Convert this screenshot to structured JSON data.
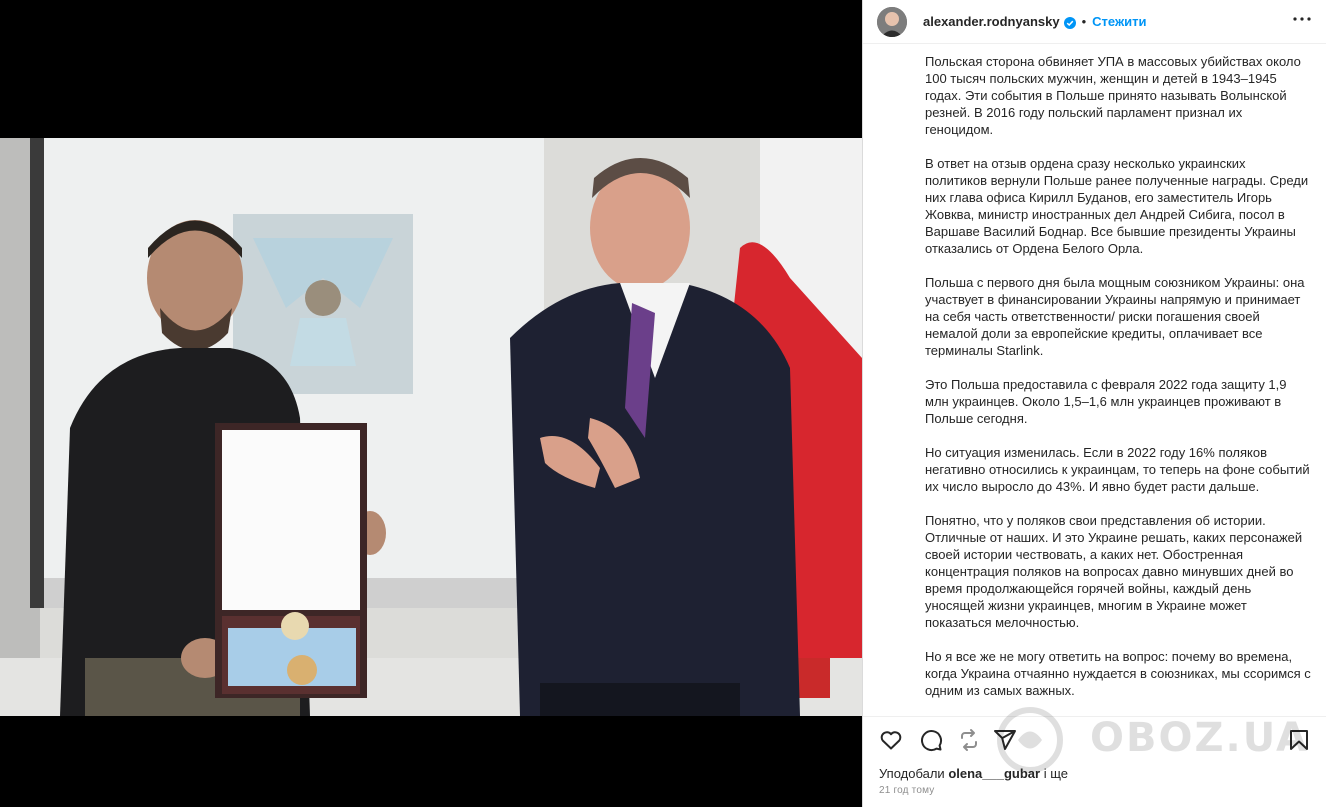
{
  "post": {
    "username": "alexander.rodnyansky",
    "follow_label": "Стежити",
    "separator": "•",
    "caption": [
      "Польская сторона обвиняет УПА в массовых убийствах около 100 тысяч польских мужчин, женщин и детей в 1943–1945 годах. Эти события в Польше принято называть Волынской резней. В 2016 году польский парламент признал их геноцидом.",
      "В ответ на отзыв ордена сразу несколько украинских политиков вернули Польше ранее полученные награды. Среди них глава офиса Кирилл Буданов, его заместитель Игорь Жовква, министр иностранных дел Андрей Сибига, посол в Варшаве Василий Боднар. Все бывшие президенты Украины отказались от Ордена Белого Орла.",
      "Польша с первого дня была мощным союзником Украины: она участвует в финансировании Украины напрямую и принимает на себя часть ответственности/ риски погашения своей немалой доли за европейские кредиты, оплачивает все терминалы Starlink.",
      "Это Польша предоставила с февраля 2022 года защиту 1,9 млн украинцев. Около 1,5–1,6 млн украинцев проживают в Польше сегодня.",
      "Но ситуация изменилась. Если в 2022 году 16% поляков негативно относились к украинцам, то теперь на фоне событий их число выросло до 43%. И явно будет расти дальше.",
      "Понятно, что у поляков свои представления об истории. Отличные от наших. И это Украине решать, каких персонажей своей истории чествовать, а каких нет. Обостренная концентрация поляков на вопросах давно минувших дней во время продолжающейся горячей войны, каждый день уносящей жизни украинцев, многим в Украине может показаться мелочностью.",
      "Но я все же не могу ответить на вопрос: почему во времена, когда Украина отчаянно нуждается в союзниках, мы ссоримся с одним из самых важных."
    ],
    "likes_prefix": "Уподобали ",
    "likes_user": "olena___gubar",
    "likes_suffix": " і ще",
    "time_ago": "21 год тому"
  },
  "watermark": "OBOZ.UA",
  "icons": {
    "verified": "verified-badge-icon",
    "more": "more-options-icon",
    "like": "heart-icon",
    "comment": "comment-icon",
    "repost": "repost-icon",
    "share": "share-icon",
    "save": "bookmark-icon"
  },
  "colors": {
    "accent": "#0095f6",
    "verified": "#0095f6",
    "text": "#262626",
    "muted": "#8e8e8e"
  }
}
